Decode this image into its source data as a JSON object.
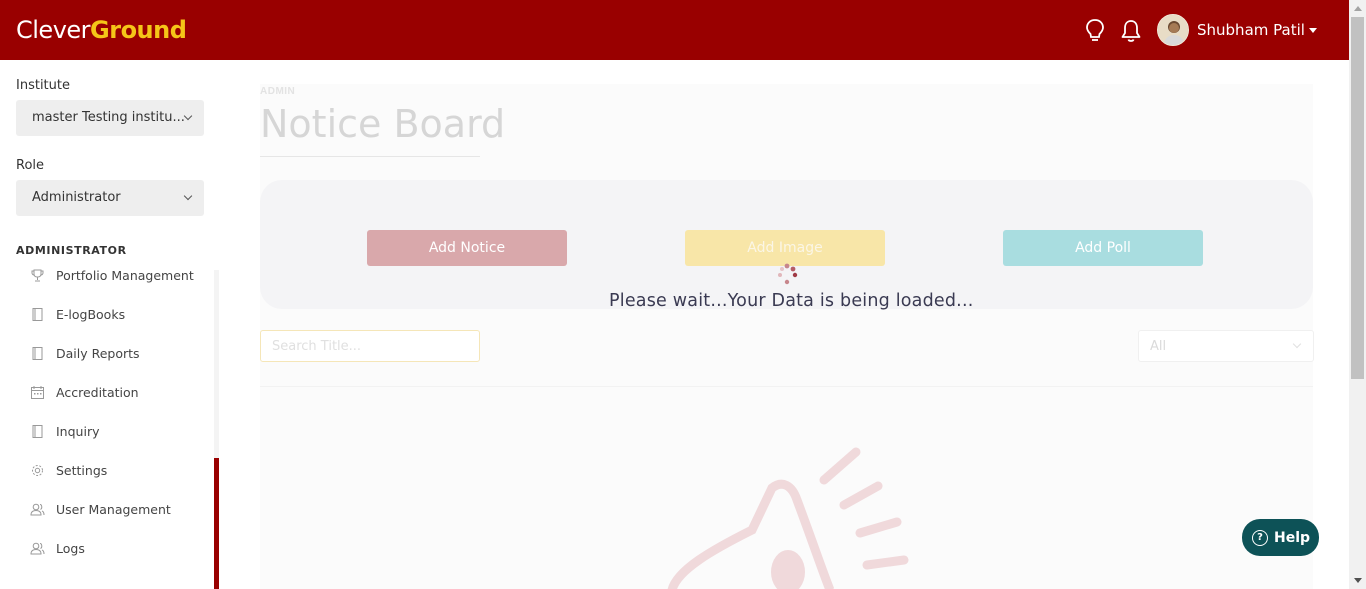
{
  "header": {
    "logo_part1": "Clever",
    "logo_part2": "Ground",
    "icons": [
      "lightbulb-icon",
      "bell-icon"
    ],
    "user_name": "Shubham Patil"
  },
  "sidebar": {
    "institute_label": "Institute",
    "institute_value": "master Testing institu...",
    "role_label": "Role",
    "role_value": "Administrator",
    "section_heading": "ADMINISTRATOR",
    "items": [
      {
        "label": "Portfolio Management",
        "icon": "trophy-icon"
      },
      {
        "label": "E-logBooks",
        "icon": "book-icon"
      },
      {
        "label": "Daily Reports",
        "icon": "book-icon"
      },
      {
        "label": "Accreditation",
        "icon": "calendar-icon"
      },
      {
        "label": "Inquiry",
        "icon": "book-icon"
      },
      {
        "label": "Settings",
        "icon": "gear-icon"
      },
      {
        "label": "User Management",
        "icon": "users-icon"
      },
      {
        "label": "Logs",
        "icon": "users-icon"
      }
    ]
  },
  "main": {
    "breadcrumb": "ADMIN",
    "title": "Notice Board",
    "buttons": {
      "add_notice": "Add Notice",
      "add_image": "Add Image",
      "add_poll": "Add Poll"
    },
    "search_placeholder": "Search Title...",
    "filter_value": "All"
  },
  "loader": {
    "text": "Please wait...Your Data is being loaded..."
  },
  "help": {
    "label": "Help"
  },
  "colors": {
    "brand": "#990000",
    "logo_accent": "#f5c518",
    "help_bg": "#0d5257"
  }
}
